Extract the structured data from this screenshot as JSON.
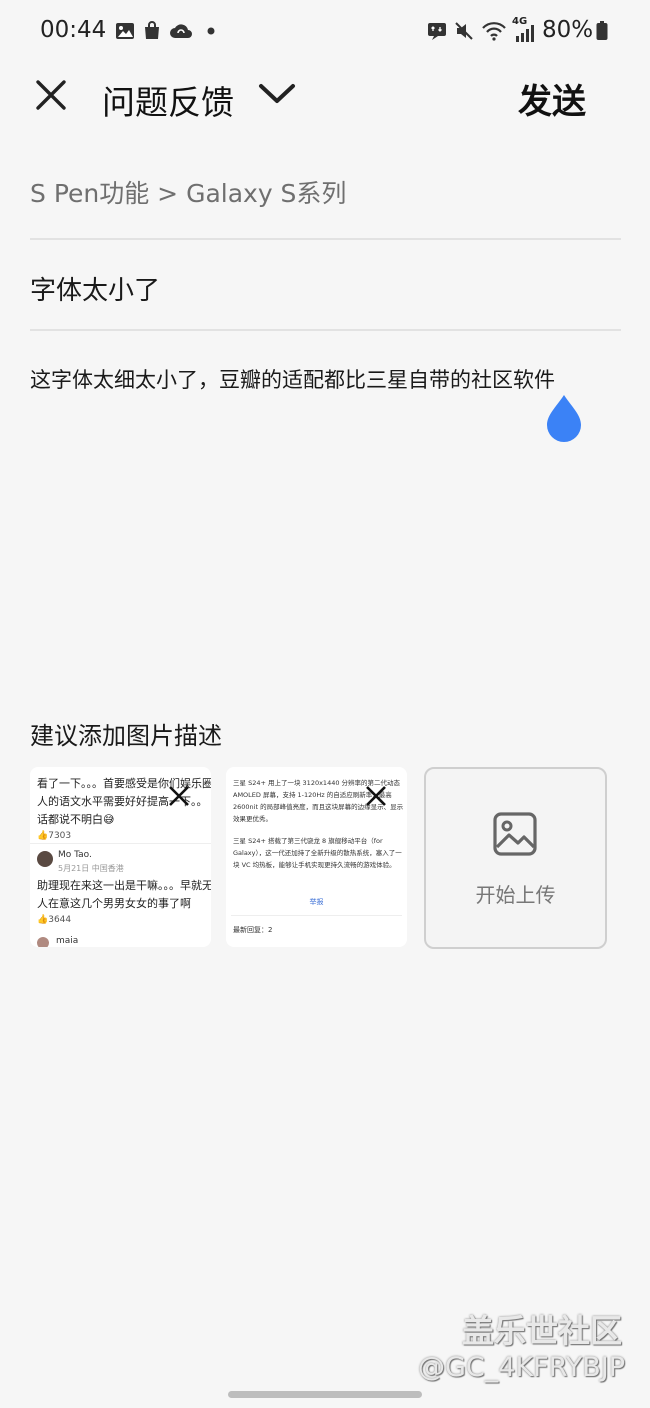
{
  "status_bar": {
    "time": "00:44",
    "battery": "80%",
    "network": "4G",
    "icons": [
      "gallery-icon",
      "shopping-bag-icon",
      "cloud-sync-icon",
      "dot-icon",
      "data-saver-icon",
      "mute-icon",
      "wifi-icon",
      "signal-icon",
      "battery-icon"
    ]
  },
  "header": {
    "title": "问题反馈",
    "send_label": "发送"
  },
  "form": {
    "category": "S Pen功能 > Galaxy S系列",
    "subject": "字体太小了",
    "body": "这字体太细太小了，豆瓣的适配都比三星自带的社区软件",
    "image_hint": "建议添加图片描述",
    "upload_label": "开始上传"
  },
  "thumb1": {
    "lines": [
      "看了一下。。。首要感受是你们娱乐圈",
      "人的语文水平需要好好提高一下。。",
      "话都说不明白😅"
    ],
    "likes1": "7303",
    "user": "Mo Tao.",
    "date": "5月21日 中国香港",
    "reply_lines": [
      "助理现在来这一出是干嘛。。。早就无",
      "人在意这几个男男女女的事了啊"
    ],
    "likes2": "3644",
    "user2": "maia"
  },
  "thumb2": {
    "p1": [
      "三星 S24+ 用上了一块 3120x1440 分辨率的第二代动态",
      "AMOLED 屏幕，支持 1-120Hz 的自适应刷新率，最高",
      "2600nit 的局部峰值亮度，而且这块屏幕的边缘显示、显示",
      "效果更优秀。"
    ],
    "p2": [
      "三星 S24+ 搭载了第三代骁龙 8 旗舰移动平台（for",
      "Galaxy），这一代还加持了全新升级的散热系统，塞入了一",
      "块 VC 均热板，能够让手机实现更持久流畅的游戏体验。"
    ],
    "report": "举报",
    "latest": "最新回复：2"
  },
  "watermark": {
    "line1": "盖乐世社区",
    "line2": "@GC_4KFRYBJP"
  },
  "colors": {
    "accent_drop": "#3b82f6",
    "background": "#f6f6f6"
  }
}
